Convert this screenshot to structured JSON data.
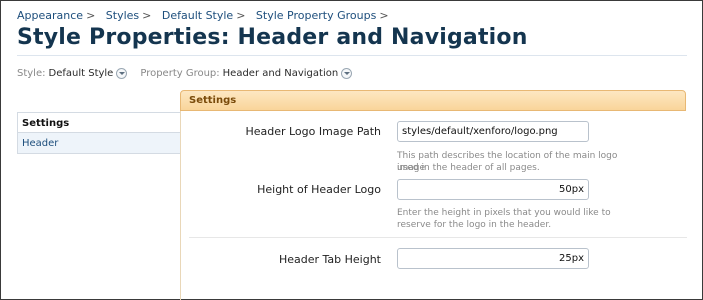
{
  "breadcrumb": [
    {
      "label": "Appearance"
    },
    {
      "label": "Styles"
    },
    {
      "label": "Default Style"
    },
    {
      "label": "Style Property Groups"
    }
  ],
  "breadcrumb_separator": ">",
  "page_title": "Style Properties: Header and Navigation",
  "filters": {
    "style_label": "Style:",
    "style_value": "Default Style",
    "group_label": "Property Group:",
    "group_value": "Header and Navigation"
  },
  "sidebar": {
    "items": [
      {
        "label": "Settings",
        "active": true
      },
      {
        "label": "Header",
        "active": false
      }
    ]
  },
  "panel": {
    "title": "Settings",
    "header_color": "#f9d59a",
    "rows": [
      {
        "label": "Header Logo Image Path",
        "value": "styles/default/xenforo/logo.png",
        "hint_line1": "This path describes the location of the main logo image",
        "hint_line2": "used in the header of all pages."
      },
      {
        "label": "Height of Header Logo",
        "value": "50px",
        "hint_line1": "Enter the height in pixels that you would like to",
        "hint_line2": "reserve for the logo in the header."
      },
      {
        "label": "Header Tab Height",
        "value": "25px"
      }
    ]
  }
}
